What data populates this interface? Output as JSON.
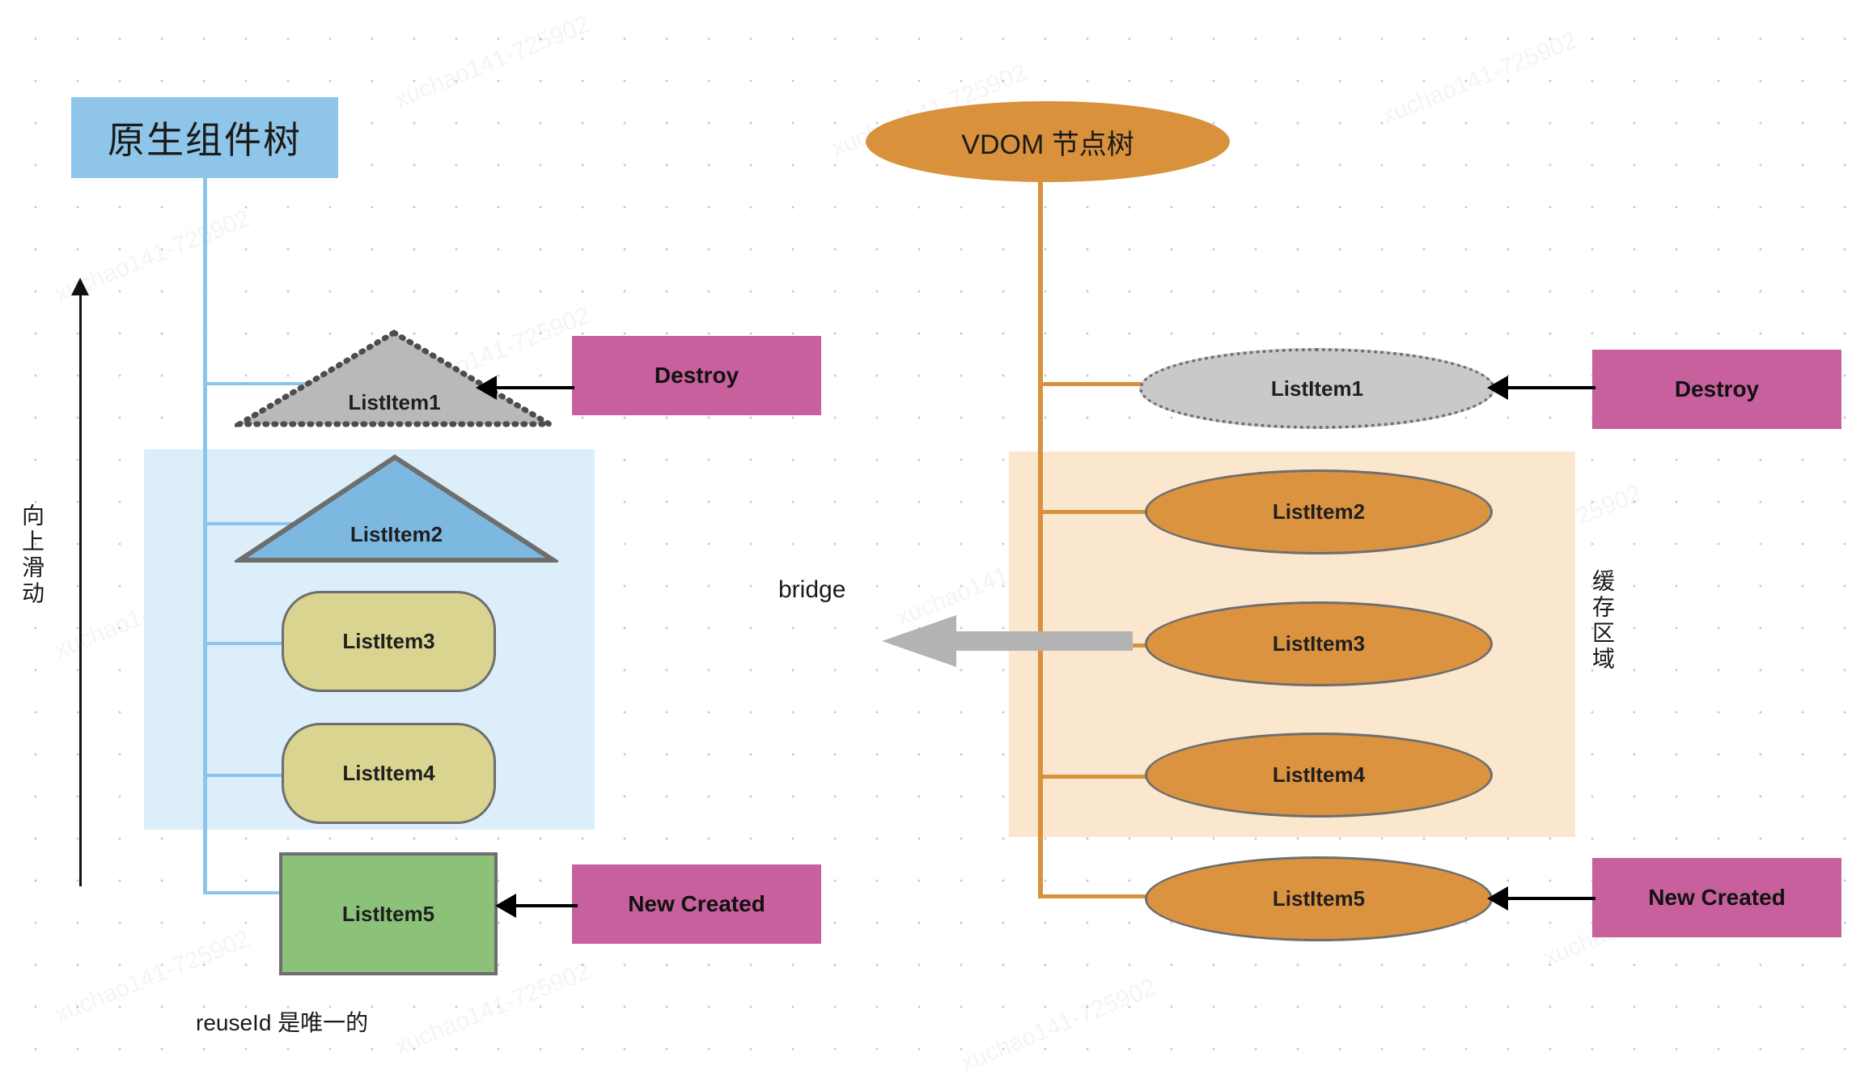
{
  "diagram": {
    "left_tree": {
      "title": "原生组件树",
      "footnote": "reuseId 是唯一的",
      "scroll_hint": "向上滑动",
      "nodes": [
        {
          "id": "left-listitem1",
          "label": "ListItem1",
          "shape": "triangle-dotted",
          "color": "#b9b9b9"
        },
        {
          "id": "left-listitem2",
          "label": "ListItem2",
          "shape": "triangle",
          "color": "#7db8e0"
        },
        {
          "id": "left-listitem3",
          "label": "ListItem3",
          "shape": "rounded-rect",
          "color": "#d9d490"
        },
        {
          "id": "left-listitem4",
          "label": "ListItem4",
          "shape": "rounded-rect",
          "color": "#d9d490"
        },
        {
          "id": "left-listitem5",
          "label": "ListItem5",
          "shape": "rect",
          "color": "#8bc178"
        }
      ]
    },
    "right_tree": {
      "title": "VDOM 节点树",
      "cache_label": "缓存区域",
      "nodes": [
        {
          "id": "right-listitem1",
          "label": "ListItem1",
          "shape": "ellipse-dotted",
          "color": "#c9c9c9"
        },
        {
          "id": "right-listitem2",
          "label": "ListItem2",
          "shape": "ellipse",
          "color": "#dc9340"
        },
        {
          "id": "right-listitem3",
          "label": "ListItem3",
          "shape": "ellipse",
          "color": "#dc9340"
        },
        {
          "id": "right-listitem4",
          "label": "ListItem4",
          "shape": "ellipse",
          "color": "#dc9340"
        },
        {
          "id": "right-listitem5",
          "label": "ListItem5",
          "shape": "ellipse",
          "color": "#dc9340"
        }
      ]
    },
    "actions": {
      "destroy_left": "Destroy",
      "destroy_right": "Destroy",
      "new_created_left": "New Created",
      "new_created_right": "New Created"
    },
    "bridge": {
      "label": "bridge"
    },
    "colors": {
      "title_blue": "#8ec5e8",
      "title_orange": "#d9913c",
      "action_pink": "#c7609c",
      "region_blue": "#ddeefb",
      "region_peach": "#fbe6ce",
      "tree_line_blue": "#8cc5ec",
      "tree_line_orange": "#d9913c",
      "node_gray": "#c9c9c9",
      "node_blue": "#7db8e0",
      "node_khaki": "#d9d490",
      "node_green": "#8bc178",
      "node_orange": "#dc9340",
      "bridge_gray": "#b3b3b3"
    },
    "watermarks": [
      "xuchao141-725902",
      "xuchao141-725902",
      "xuchao141-725902",
      "xuchao141-725902",
      "xuchao141-725902",
      "xuchao141-725902",
      "xuchao141-725902",
      "xuchao141-725902",
      "xuchao141-725902",
      "xuchao141-725902",
      "xuchao141-725902",
      "xuchao141-725902"
    ]
  }
}
